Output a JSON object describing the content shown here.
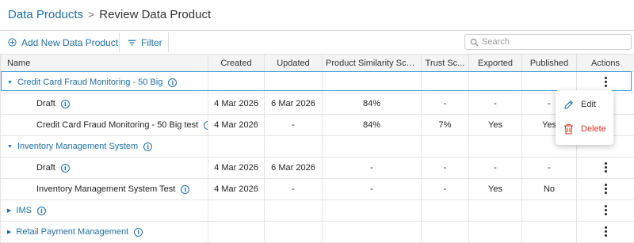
{
  "breadcrumb": {
    "parent": "Data Products",
    "separator": ">",
    "current": "Review Data Product"
  },
  "toolbar": {
    "add_label": "Add New Data Product",
    "filter_label": "Filter"
  },
  "search": {
    "placeholder": "Search",
    "value": ""
  },
  "table": {
    "columns": [
      "Name",
      "Created",
      "Updated",
      "Product Similarity Score",
      "Trust Sc...",
      "Exported",
      "Published",
      "Actions"
    ],
    "rows": [
      {
        "type": "group",
        "name": "Credit Card Fraud Monitoring - 50 Big",
        "selected": true
      },
      {
        "type": "child",
        "name": "Draft",
        "created": "4 Mar 2026",
        "updated": "6 Mar 2026",
        "similarity": "84%",
        "trust": "-",
        "exported": "-",
        "published": "-"
      },
      {
        "type": "child",
        "name": "Credit Card Fraud Monitoring - 50 Big test",
        "created": "4 Mar 2026",
        "updated": "-",
        "similarity": "84%",
        "trust": "7%",
        "exported": "Yes",
        "published": "Yes"
      },
      {
        "type": "group",
        "name": "Inventory Management System"
      },
      {
        "type": "child",
        "name": "Draft",
        "created": "4 Mar 2026",
        "updated": "6 Mar 2026",
        "similarity": "-",
        "trust": "-",
        "exported": "-",
        "published": "-"
      },
      {
        "type": "child",
        "name": "Inventory Management System Test",
        "created": "4 Mar 2026",
        "updated": "-",
        "similarity": "-",
        "trust": "-",
        "exported": "Yes",
        "published": "No"
      },
      {
        "type": "group",
        "name": "IMS"
      },
      {
        "type": "group",
        "name": "Retail Payment Management"
      }
    ]
  },
  "context_menu": {
    "edit_label": "Edit",
    "delete_label": "Delete"
  },
  "colors": {
    "accent": "#1f6fa3",
    "selection": "#3a9ad9",
    "danger": "#d9342b"
  },
  "icons": [
    "add-circle-icon",
    "filter-icon",
    "search-icon",
    "info-icon",
    "caret-down-icon",
    "caret-right-icon",
    "kebab-menu-icon",
    "pencil-icon",
    "trash-icon"
  ]
}
